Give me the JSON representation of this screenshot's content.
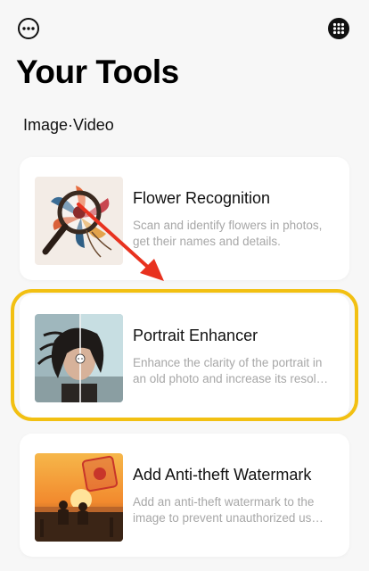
{
  "header": {
    "more_icon": "more-dots-icon",
    "apps_icon": "apps-grid-icon",
    "title": "Your Tools"
  },
  "section": {
    "label": "Image·Video"
  },
  "tools": [
    {
      "title": "Flower Recognition",
      "description": "Scan and identify flowers in photos, get their names and details."
    },
    {
      "title": "Portrait Enhancer",
      "description": "Enhance the clarity of the portrait in an old photo and increase its resol…"
    },
    {
      "title": "Add Anti-theft Watermark",
      "description": "Add an anti-theft watermark to the image to prevent unauthorized us…"
    }
  ],
  "colors": {
    "highlight": "#f2c012",
    "arrow": "#e8321f",
    "card_bg": "#ffffff",
    "page_bg": "#f7f7f7",
    "desc_text": "#a7a7a7"
  }
}
